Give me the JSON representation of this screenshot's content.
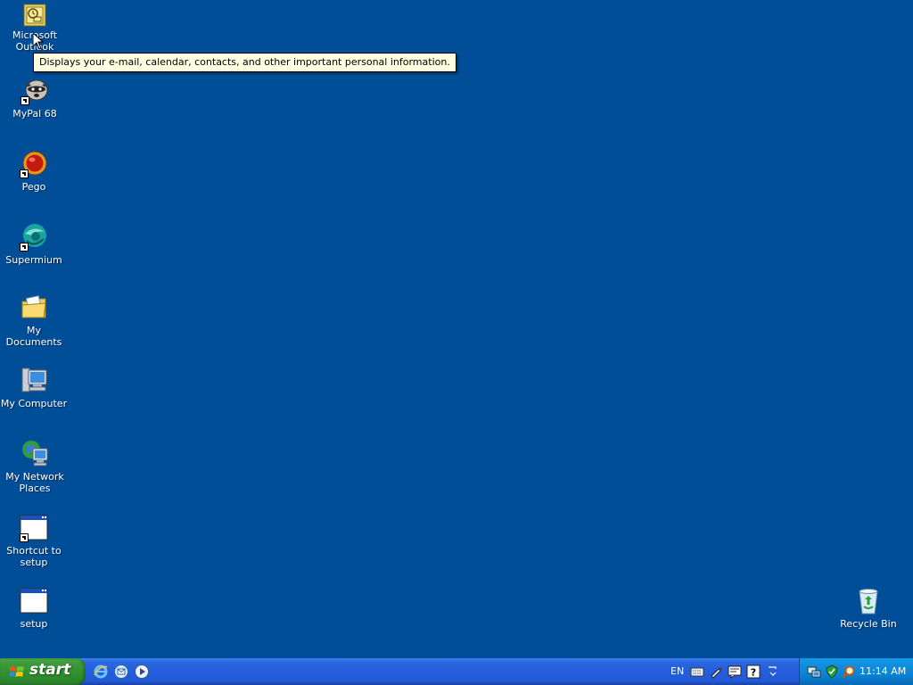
{
  "desktop": {
    "background_color": "#004e98",
    "icons": [
      {
        "label": "Microsoft Outlook",
        "icon": "outlook-icon"
      },
      {
        "label": "MyPal 68",
        "icon": "mypal-raccoon-icon"
      },
      {
        "label": "Pego",
        "icon": "pego-icon"
      },
      {
        "label": "Supermium",
        "icon": "supermium-icon"
      },
      {
        "label": "My Documents",
        "icon": "folder-icon"
      },
      {
        "label": "My Computer",
        "icon": "computer-icon"
      },
      {
        "label": "My Network Places",
        "icon": "network-icon"
      },
      {
        "label": "Shortcut to setup",
        "icon": "window-icon"
      },
      {
        "label": "setup",
        "icon": "window-icon"
      },
      {
        "label": "Recycle Bin",
        "icon": "recycle-bin-icon"
      }
    ],
    "tooltip": "Displays your e-mail, calendar, contacts, and other important personal information."
  },
  "taskbar": {
    "start_label": "start",
    "quick_launch": [
      "internet-explorer-icon",
      "outlook-express-icon",
      "media-player-icon"
    ],
    "language": "EN",
    "clock": "11:14 AM"
  }
}
